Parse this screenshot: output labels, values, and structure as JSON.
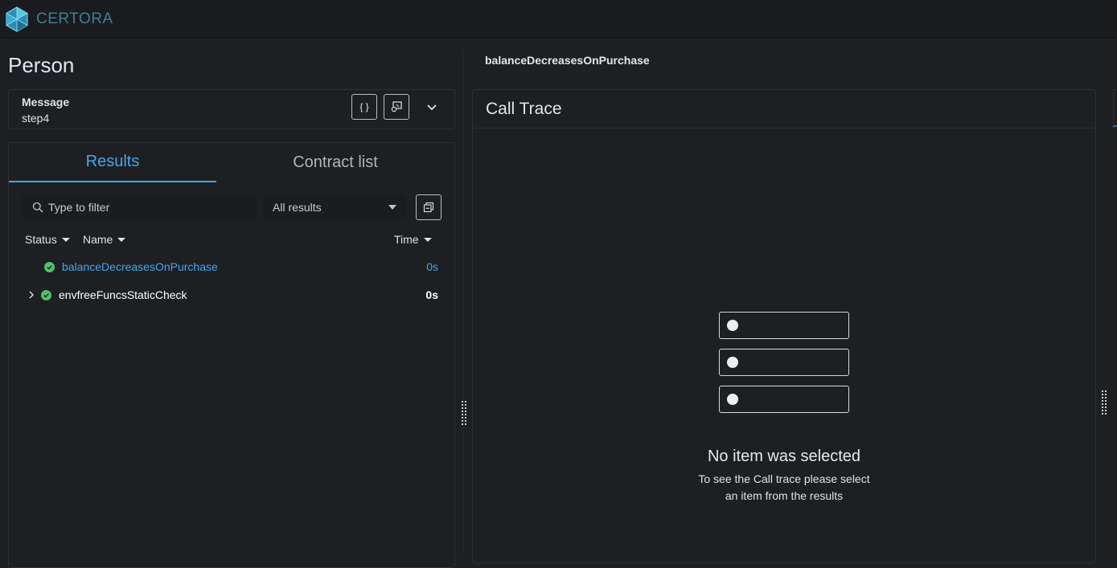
{
  "app": {
    "brand": "CERTORA",
    "accent": "#44a6e9",
    "success": "#4cc36b"
  },
  "page": {
    "title": "Person"
  },
  "message": {
    "label": "Message",
    "value": "step4",
    "json_icon": "{ }"
  },
  "tabs": [
    {
      "label": "Results",
      "active": true
    },
    {
      "label": "Contract list",
      "active": false
    }
  ],
  "filter": {
    "placeholder": "Type to filter",
    "select_value": "All results"
  },
  "columns": {
    "status": "Status",
    "name": "Name",
    "time": "Time"
  },
  "results": [
    {
      "name": "balanceDecreasesOnPurchase",
      "time": "0s",
      "status": "verified",
      "selected": true
    },
    {
      "name": "envfreeFuncsStaticCheck",
      "time": "0s",
      "status": "verified",
      "expandable": true
    }
  ],
  "right": {
    "rule_title": "balanceDecreasesOnPurchase",
    "panel_title": "Call Trace",
    "empty_title": "No item was selected",
    "empty_desc_line1": "To see the Call trace please select",
    "empty_desc_line2": "an item from the results"
  }
}
